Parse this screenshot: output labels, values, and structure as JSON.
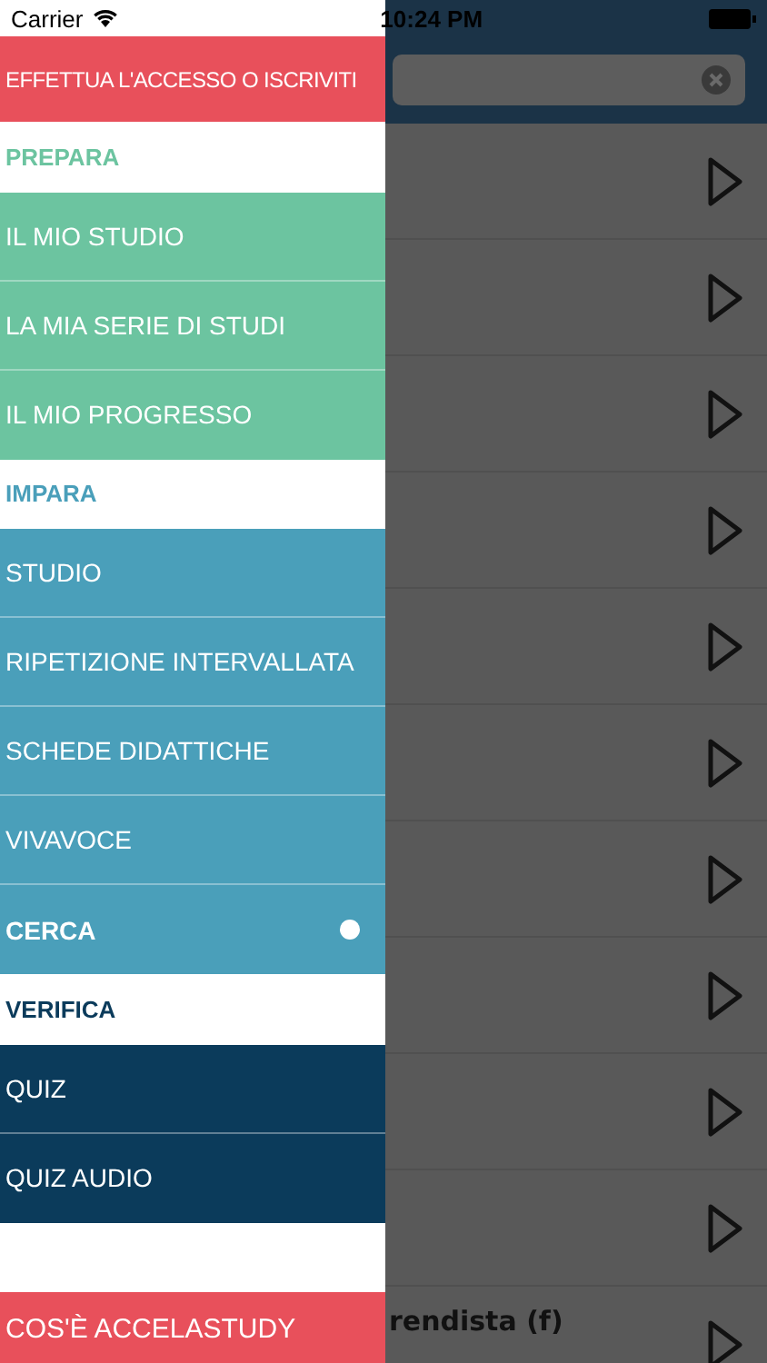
{
  "status_bar": {
    "carrier": "Carrier",
    "time": "10:24 PM"
  },
  "drawer": {
    "login": "EFFETTUA L'ACCESSO O ISCRIVITI",
    "sections": [
      {
        "title": "PREPARA",
        "color": "#6cc4a0",
        "items": [
          {
            "label": "IL MIO STUDIO",
            "selected": false
          },
          {
            "label": "LA MIA SERIE DI STUDI",
            "selected": false
          },
          {
            "label": "IL MIO PROGRESSO",
            "selected": false
          }
        ]
      },
      {
        "title": "IMPARA",
        "color": "#4a9fba",
        "items": [
          {
            "label": "STUDIO",
            "selected": false
          },
          {
            "label": "RIPETIZIONE INTERVALLATA",
            "selected": false
          },
          {
            "label": "SCHEDE DIDATTICHE",
            "selected": false
          },
          {
            "label": "VIVAVOCE",
            "selected": false
          },
          {
            "label": "CERCA",
            "selected": true
          }
        ]
      },
      {
        "title": "VERIFICA",
        "color": "#0b3b5b",
        "items": [
          {
            "label": "QUIZ",
            "selected": false
          },
          {
            "label": "QUIZ AUDIO",
            "selected": false
          }
        ]
      }
    ],
    "footer": "COS'È ACCELASTUDY"
  },
  "list": {
    "rows": [
      {
        "kind": "audio"
      },
      {
        "kind": "audio"
      },
      {
        "kind": "audio"
      },
      {
        "kind": "audio"
      },
      {
        "kind": "audio"
      },
      {
        "kind": "audio"
      },
      {
        "kind": "audio"
      },
      {
        "kind": "audio"
      },
      {
        "kind": "audio"
      },
      {
        "kind": "audio"
      },
      {
        "kind": "audio",
        "title": "rendista (f)"
      }
    ]
  }
}
